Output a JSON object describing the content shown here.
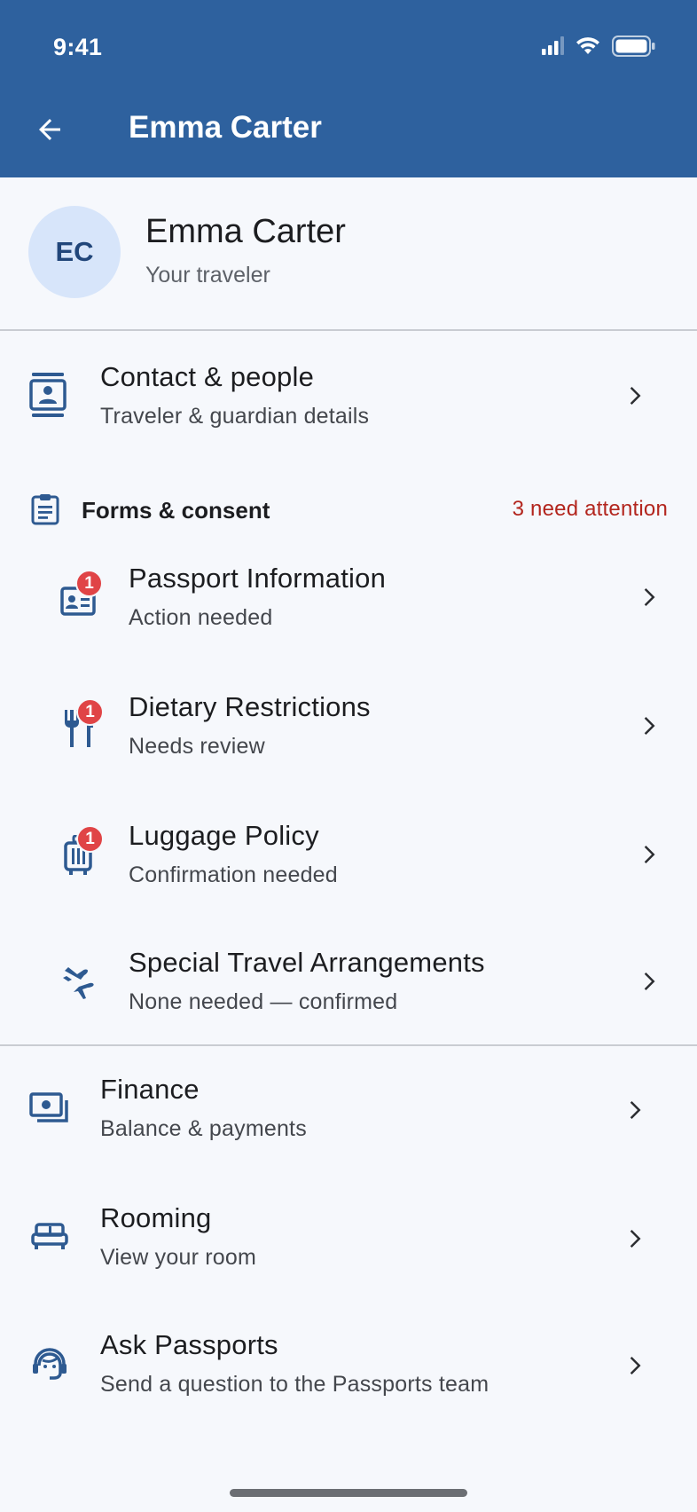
{
  "status_bar": {
    "time": "9:41"
  },
  "app_bar": {
    "title": "Emma Carter"
  },
  "traveler": {
    "initials": "EC",
    "name": "Emma Carter",
    "subtitle": "Your traveler"
  },
  "contact": {
    "title": "Contact & people",
    "subtitle": "Traveler & guardian details",
    "icon": "contact-card-icon"
  },
  "forms": {
    "section_title": "Forms & consent",
    "attention_text": "3 need attention",
    "items": [
      {
        "title": "Passport Information",
        "subtitle": "Action needed",
        "badge": "1",
        "icon": "passport-id-icon"
      },
      {
        "title": "Dietary Restrictions",
        "subtitle": "Needs review",
        "badge": "1",
        "icon": "fork-knife-icon"
      },
      {
        "title": "Luggage Policy",
        "subtitle": "Confirmation needed",
        "badge": "1",
        "icon": "luggage-icon"
      },
      {
        "title": "Special Travel Arrangements",
        "subtitle": "None needed — confirmed",
        "badge": null,
        "icon": "travel-plane-icon"
      }
    ]
  },
  "more": [
    {
      "title": "Finance",
      "subtitle": "Balance & payments",
      "icon": "money-icon"
    },
    {
      "title": "Rooming",
      "subtitle": "View your room",
      "icon": "bed-icon"
    },
    {
      "title": "Ask Passports",
      "subtitle": "Send a question to the Passports team",
      "icon": "support-agent-icon"
    }
  ],
  "colors": {
    "primary": "#2e619e",
    "icon": "#2e5a91",
    "badge": "#e04446",
    "warning_text": "#b3261e",
    "background": "#f6f8fc"
  }
}
